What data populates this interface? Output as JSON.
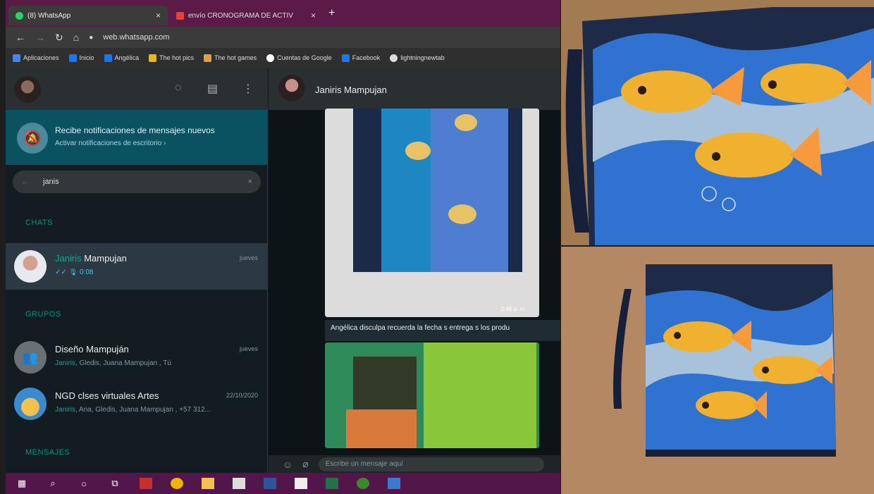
{
  "browser": {
    "tabs": [
      {
        "label": "(8) WhatsApp",
        "close": "×"
      },
      {
        "label": "envío CRONOGRAMA DE ACTIV",
        "close": "×"
      }
    ],
    "new_tab": "+",
    "url": "web.whatsapp.com",
    "bookmarks": [
      "Aplicaciones",
      "Inicio",
      "Angélica",
      "The hot pics",
      "The hot games",
      "Cuentas de Google",
      "Facebook",
      "lightningnewtab"
    ]
  },
  "notification": {
    "title": "Recibe notificaciones de mensajes nuevos",
    "subtitle": "Activar notificaciones de escritorio ›"
  },
  "search": {
    "value": "janis"
  },
  "sections": {
    "chats": "CHATS",
    "groups": "GRUPOS",
    "messages": "MENSAJES"
  },
  "chats": [
    {
      "name_highlight": "Janiris",
      "name_rest": " Mampujan",
      "preview": "✓✓ 🎙 0:08",
      "time": "jueves"
    }
  ],
  "groups": [
    {
      "name": "Diseño Mampuján",
      "preview_highlight": "Janiris",
      "preview_rest": ", Gledis, Juana Mampujan , Tú",
      "time": "jueves"
    },
    {
      "name": "NGD clses virtuales Artes",
      "preview_highlight": "Janiris",
      "preview_rest": ", Ana, Gledis, Juana Mampujan , +57 312...",
      "time": "22/10/2020"
    }
  ],
  "chat": {
    "name": "Janiris Mampujan",
    "image_time": "2:48 p. m.",
    "caption": "Angélica disculpa recuerda la fecha s entrega s los produ",
    "compose_placeholder": "Escribe un mensaje aquí"
  },
  "colors": {
    "accent": "#009688",
    "tab_bar": "#5b1a47",
    "taskbar": "#53164a"
  }
}
